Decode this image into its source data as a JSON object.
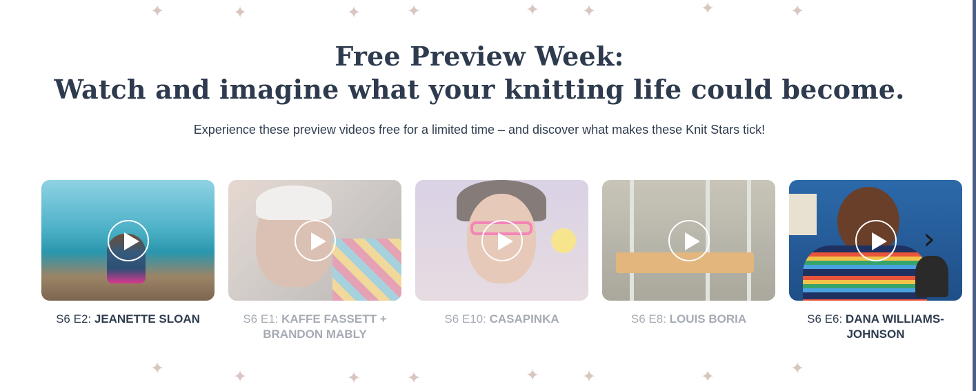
{
  "headline": {
    "line1": "Free Preview Week:",
    "line2": "Watch and imagine what your knitting life could become."
  },
  "subtitle": "Experience these preview videos free for a limited time – and discover what makes these Knit Stars tick!",
  "carousel": {
    "items": [
      {
        "episode": "S6 E2: ",
        "name_line1": "JEANETTE SLOAN",
        "name_line2": "",
        "active": true
      },
      {
        "episode": "S6 E1: ",
        "name_line1": "KAFFE FASSETT +",
        "name_line2": "BRANDON MABLY",
        "active": false
      },
      {
        "episode": "S6 E10: ",
        "name_line1": "CASAPINKA",
        "name_line2": "",
        "active": false
      },
      {
        "episode": "S6 E8: ",
        "name_line1": "LOUIS BORIA",
        "name_line2": "",
        "active": false
      },
      {
        "episode": "S6 E6: ",
        "name_line1": "DANA WILLIAMS-",
        "name_line2": "JOHNSON",
        "active": true
      }
    ],
    "play_icon": "play-icon",
    "next_icon": "chevron-right-icon",
    "next_glyph": "›"
  },
  "decor": {
    "sparkle_glyph": "✦"
  },
  "colors": {
    "text": "#2e3b4e",
    "muted": "#a6abb3",
    "accent_rule": "#4b5f86"
  }
}
